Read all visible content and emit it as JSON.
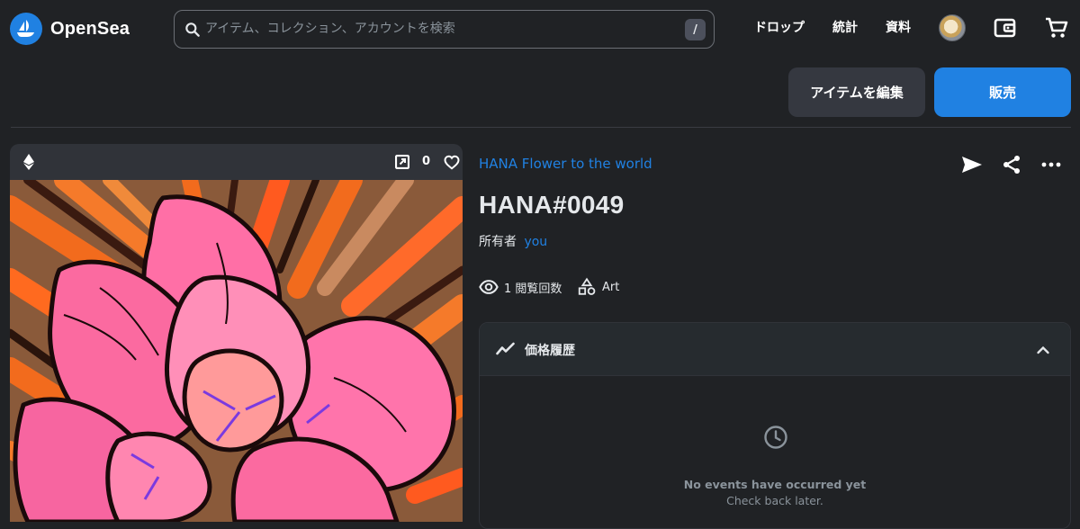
{
  "header": {
    "brand": "OpenSea",
    "search": {
      "placeholder": "アイテム、コレクション、アカウントを検索",
      "shortcut": "/"
    },
    "nav": [
      "ドロップ",
      "統計",
      "資料"
    ],
    "icons": [
      "avatar",
      "wallet-icon",
      "cart-icon"
    ]
  },
  "actions": {
    "edit_label": "アイテムを編集",
    "sell_label": "販売"
  },
  "media": {
    "favorites_count": "0",
    "icons": [
      "ethereum-icon",
      "external-link-icon",
      "heart-icon"
    ]
  },
  "item": {
    "collection": "HANA Flower to the world",
    "title": "HANA#0049",
    "owner_label": "所有者",
    "owner_name": "you",
    "views": "1 閲覧回数",
    "category": "Art"
  },
  "price_history": {
    "title": "価格履歴",
    "empty_title": "No events have occurred yet",
    "empty_sub": "Check back later."
  },
  "colors": {
    "accent": "#2081e2",
    "background": "#202225",
    "card": "#303339"
  }
}
